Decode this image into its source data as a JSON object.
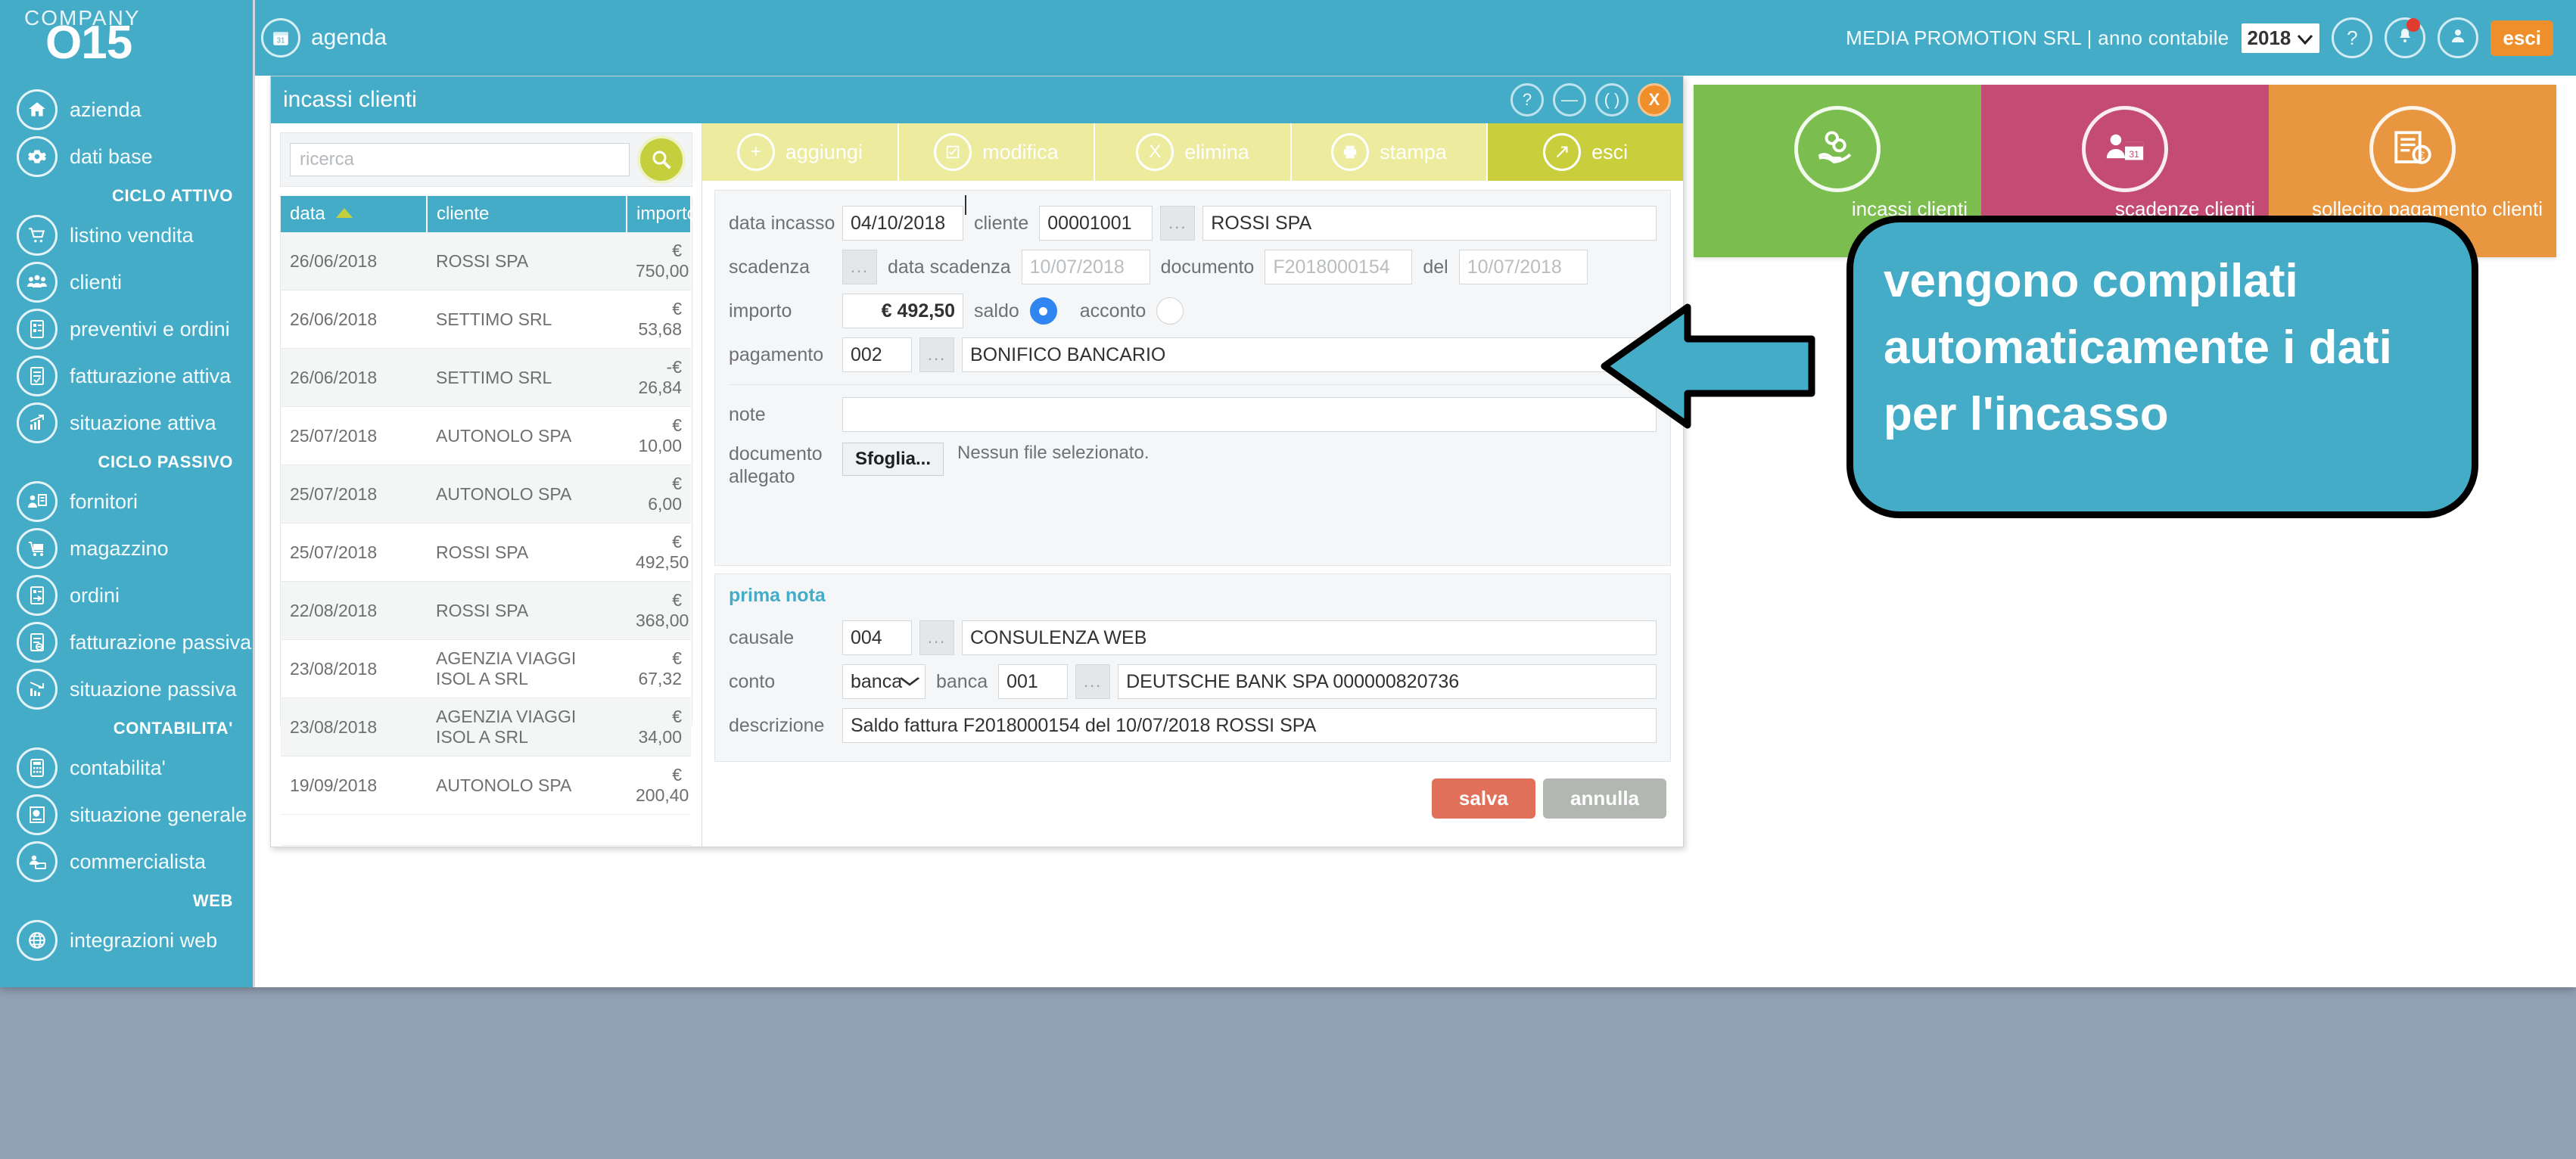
{
  "brand": {
    "company": "COMPANY",
    "product": "O15"
  },
  "topbar": {
    "module_label": "agenda",
    "module_icon": "calendar-icon",
    "context_text": "MEDIA PROMOTION SRL | anno contabile",
    "year": "2018",
    "help_label": "?",
    "notifications_icon": "bell-icon",
    "user_icon": "user-icon",
    "logout_label": "esci"
  },
  "sidebar": {
    "items": [
      {
        "label": "azienda",
        "icon": "home-icon",
        "type": "item"
      },
      {
        "label": "dati base",
        "icon": "gear-icon",
        "type": "item"
      },
      {
        "label": "CICLO ATTIVO",
        "type": "section"
      },
      {
        "label": "listino vendita",
        "icon": "cart-icon",
        "type": "item"
      },
      {
        "label": "clienti",
        "icon": "users-icon",
        "type": "item"
      },
      {
        "label": "preventivi e ordini",
        "icon": "document-list-icon",
        "type": "item"
      },
      {
        "label": "fatturazione attiva",
        "icon": "invoice-check-icon",
        "type": "item"
      },
      {
        "label": "situazione attiva",
        "icon": "chart-up-icon",
        "type": "item"
      },
      {
        "label": "CICLO PASSIVO",
        "type": "section"
      },
      {
        "label": "fornitori",
        "icon": "supplier-icon",
        "type": "item"
      },
      {
        "label": "magazzino",
        "icon": "warehouse-cart-icon",
        "type": "item"
      },
      {
        "label": "ordini",
        "icon": "order-icon",
        "type": "item"
      },
      {
        "label": "fatturazione passiva",
        "icon": "invoice-minus-icon",
        "type": "item"
      },
      {
        "label": "situazione passiva",
        "icon": "chart-down-icon",
        "type": "item"
      },
      {
        "label": "CONTABILITA'",
        "type": "section"
      },
      {
        "label": "contabilita'",
        "icon": "calculator-icon",
        "type": "item"
      },
      {
        "label": "situazione generale",
        "icon": "report-pie-icon",
        "type": "item"
      },
      {
        "label": "commercialista",
        "icon": "accountant-icon",
        "type": "item"
      },
      {
        "label": "WEB",
        "type": "section"
      },
      {
        "label": "integrazioni web",
        "icon": "globe-icon",
        "type": "item"
      }
    ]
  },
  "dialog": {
    "title": "incassi clienti",
    "controls": {
      "help": "?",
      "minimize": "—",
      "restore": "( )",
      "close": "X"
    },
    "search": {
      "placeholder": "ricerca",
      "button_icon": "search-icon"
    },
    "table": {
      "columns": [
        "data",
        "cliente",
        "importo"
      ],
      "sort_column": "data",
      "sort_direction": "asc",
      "rows": [
        {
          "data": "26/06/2018",
          "cliente": "ROSSI SPA",
          "importo": "€ 750,00"
        },
        {
          "data": "26/06/2018",
          "cliente": "SETTIMO SRL",
          "importo": "€ 53,68"
        },
        {
          "data": "26/06/2018",
          "cliente": "SETTIMO SRL",
          "importo": "-€ 26,84"
        },
        {
          "data": "25/07/2018",
          "cliente": "AUTONOLO SPA",
          "importo": "€ 10,00"
        },
        {
          "data": "25/07/2018",
          "cliente": "AUTONOLO SPA",
          "importo": "€ 6,00"
        },
        {
          "data": "25/07/2018",
          "cliente": "ROSSI SPA",
          "importo": "€ 492,50"
        },
        {
          "data": "22/08/2018",
          "cliente": "ROSSI SPA",
          "importo": "€ 368,00"
        },
        {
          "data": "23/08/2018",
          "cliente": "AGENZIA VIAGGI ISOL A SRL",
          "importo": "€ 67,32"
        },
        {
          "data": "23/08/2018",
          "cliente": "AGENZIA VIAGGI ISOL A SRL",
          "importo": "€ 34,00"
        },
        {
          "data": "19/09/2018",
          "cliente": "AUTONOLO SPA",
          "importo": "€ 200,40"
        }
      ]
    },
    "toolbar": [
      {
        "label": "aggiungi",
        "icon": "plus-icon",
        "active": false
      },
      {
        "label": "modifica",
        "icon": "edit-icon",
        "active": false
      },
      {
        "label": "elimina",
        "icon": "x-icon",
        "active": false
      },
      {
        "label": "stampa",
        "icon": "printer-icon",
        "active": false
      },
      {
        "label": "esci",
        "icon": "exit-arrow-icon",
        "active": true
      }
    ],
    "form": {
      "data_incasso_label": "data incasso",
      "data_incasso_value": "04/10/2018",
      "cliente_label": "cliente",
      "cliente_code": "00001001",
      "cliente_name": "ROSSI SPA",
      "scadenza_label": "scadenza",
      "data_scadenza_label": "data scadenza",
      "data_scadenza_value": "10/07/2018",
      "documento_label": "documento",
      "documento_value": "F2018000154",
      "del_label": "del",
      "del_value": "10/07/2018",
      "importo_label": "importo",
      "importo_value": "€ 492,50",
      "saldo_label": "saldo",
      "saldo_selected": true,
      "acconto_label": "acconto",
      "acconto_selected": false,
      "pagamento_label": "pagamento",
      "pagamento_code": "002",
      "pagamento_desc": "BONIFICO BANCARIO",
      "note_label": "note",
      "note_value": "",
      "documento_allegato_label_1": "documento",
      "documento_allegato_label_2": "allegato",
      "browse_label": "Sfoglia...",
      "no_file_label": "Nessun file selezionato.",
      "dots_label": "..."
    },
    "prima_nota": {
      "section_title": "prima nota",
      "causale_label": "causale",
      "causale_code": "004",
      "causale_desc": "CONSULENZA WEB",
      "conto_label": "conto",
      "conto_value": "banca",
      "banca_label": "banca",
      "banca_code": "001",
      "banca_desc": "DEUTSCHE BANK SPA 000000820736",
      "descrizione_label": "descrizione",
      "descrizione_value": "Saldo  fattura F2018000154 del 10/07/2018 ROSSI SPA"
    },
    "actions": {
      "save_label": "salva",
      "cancel_label": "annulla"
    }
  },
  "tiles": [
    {
      "label": "incassi clienti",
      "icon": "coins-hand-icon",
      "color": "#7bbd4e"
    },
    {
      "label": "scadenze clienti",
      "icon": "person-calendar-icon",
      "color": "#c34b74"
    },
    {
      "label": "sollecito pagamento clienti",
      "icon": "invoice-euro-icon",
      "color": "#e8963f"
    }
  ],
  "callout": {
    "text": "vengono compilati automaticamente i dati per l'incasso",
    "arrow_icon": "left-arrow-annotation"
  },
  "colors": {
    "teal": "#45acc8",
    "orange": "#ef8f2b",
    "lime": "#c8ce3c",
    "lime_light": "#eceb9e",
    "save_red": "#e0705a",
    "cancel_gray": "#b3b7b2",
    "radio_blue": "#2f86f0",
    "page_background": "#92a2b5"
  }
}
